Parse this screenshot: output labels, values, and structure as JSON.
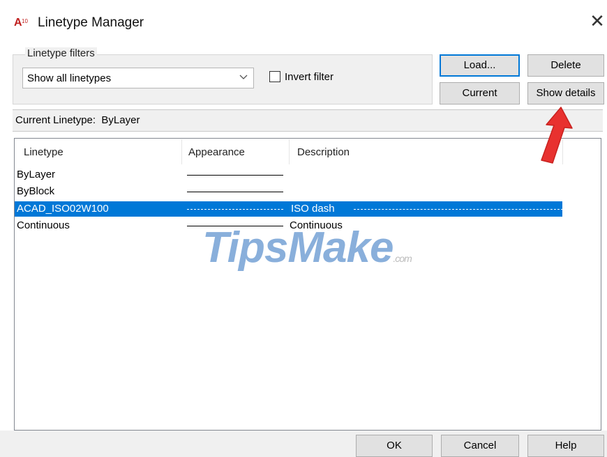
{
  "window": {
    "title": "Linetype Manager",
    "app_icon_text": "A10",
    "close_glyph": "✕"
  },
  "filters": {
    "legend": "Linetype filters",
    "selected": "Show all linetypes",
    "invert_label": "Invert filter",
    "invert_checked": false
  },
  "buttons": {
    "load": "Load...",
    "delete": "Delete",
    "current": "Current",
    "show_details": "Show details",
    "ok": "OK",
    "cancel": "Cancel",
    "help": "Help"
  },
  "current_linetype": {
    "label": "Current Linetype:",
    "value": "ByLayer"
  },
  "list": {
    "columns": [
      "Linetype",
      "Appearance",
      "Description"
    ],
    "rows": [
      {
        "name": "ByLayer",
        "appearance": "solid",
        "description": ""
      },
      {
        "name": "ByBlock",
        "appearance": "solid",
        "description": ""
      },
      {
        "name": "ACAD_ISO02W100",
        "appearance": "dashed",
        "description": "ISO dash",
        "selected": true
      },
      {
        "name": "Continuous",
        "appearance": "solid",
        "description": "Continuous"
      }
    ]
  },
  "watermark": {
    "main": "TipsMake",
    "suffix": ".com"
  },
  "colors": {
    "selection": "#0078d7",
    "annotation_arrow": "#e8312f"
  }
}
